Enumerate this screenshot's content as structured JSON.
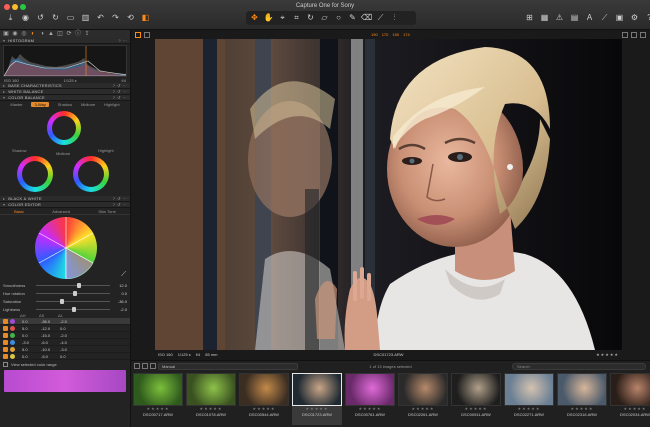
{
  "window": {
    "title": "Capture One for Sony"
  },
  "toolbar": {
    "left_icons": [
      "import-icon",
      "camera-icon",
      "undo-rotate-icon",
      "rotate-icon",
      "batch-icon",
      "trash-icon",
      "undo-icon",
      "redo-icon",
      "reset-icon",
      "copy-icon"
    ],
    "mid_icons": [
      "pan-icon",
      "hand-icon",
      "picker-icon",
      "crop-icon",
      "straighten-icon",
      "keystone-icon",
      "spot-icon",
      "brush-icon",
      "eraser-icon",
      "wb-picker-icon",
      "levels-icon"
    ],
    "right_icons": [
      "grid-icon",
      "guides-icon",
      "exposure-warning-icon",
      "focus-mask-icon",
      "text-icon",
      "eyedropper-icon",
      "proof-icon",
      "settings-icon",
      "help-icon"
    ]
  },
  "left_panel": {
    "histogram": {
      "title": "HISTOGRAM",
      "iso": "ISO 160",
      "shutter": "1/125 s",
      "aperture": "f/4"
    },
    "sections": {
      "base": "BASE CHARACTERISTICS",
      "wb": "WHITE BALANCE",
      "cb": "COLOR BALANCE",
      "bw": "BLACK & WHITE",
      "ce": "COLOR EDITOR"
    },
    "cb_tabs": [
      "Master",
      "3-Way",
      "Shadow",
      "Midtone",
      "Highlight"
    ],
    "cb_active": "3-Way",
    "wheel_labels": {
      "shadow": "Shadow",
      "midtone": "Midtone",
      "highlight": "Highlight"
    },
    "ce_tabs": [
      "Basic",
      "Advanced",
      "Skin Tone"
    ],
    "sliders": [
      {
        "label": "Smoothness",
        "value": "12.0",
        "pos": 0.55
      },
      {
        "label": "Hue rotation",
        "value": "0.0",
        "pos": 0.5
      },
      {
        "label": "Saturation",
        "value": "-36.0",
        "pos": 0.32
      },
      {
        "label": "Lightness",
        "value": "-2.0",
        "pos": 0.49
      }
    ],
    "table_head": [
      "ΔH",
      "ΔS",
      "ΔL"
    ],
    "table_rows": [
      {
        "color": "#a24bd6",
        "h": "0.0",
        "s": "-36.0",
        "l": "-2.0",
        "sel": true
      },
      {
        "color": "#e25050",
        "h": "5.0",
        "s": "-12.0",
        "l": "0.0",
        "sel": false
      },
      {
        "color": "#3fb64a",
        "h": "0.0",
        "s": "-15.0",
        "l": "-2.0",
        "sel": false
      },
      {
        "color": "#3c8be0",
        "h": "-3.0",
        "s": "-6.0",
        "l": "-4.0",
        "sel": false
      },
      {
        "color": "#e0a23a",
        "h": "5.0",
        "s": "-10.0",
        "l": "-3.0",
        "sel": false
      },
      {
        "color": "#d8c840",
        "h": "0.0",
        "s": "-5.0",
        "l": "0.0",
        "sel": false
      }
    ],
    "view_selected": "View selected color range",
    "accent": "#ff8a1a"
  },
  "viewer": {
    "top_info": [
      "190",
      "170",
      "150",
      "174"
    ],
    "bottom_info": {
      "iso": "ISO 160",
      "shutter": "1/125 s",
      "aperture": "f/4",
      "focal": "85 mm"
    },
    "filename": "DSC01723.ARW",
    "stars": "★★★★★"
  },
  "browser": {
    "sort_label": "Manual",
    "count": "1 of 13 images selected",
    "search_placeholder": "Search",
    "thumbs": [
      {
        "name": "DSC00717.ARW",
        "c1": "#2f5a1e",
        "c2": "#7bbf3a",
        "sel": false
      },
      {
        "name": "DSC01078.ARW",
        "c1": "#3a5220",
        "c2": "#8ec24a",
        "sel": false
      },
      {
        "name": "DSC00544.ARW",
        "c1": "#3a2d22",
        "c2": "#c38a4a",
        "sel": false
      },
      {
        "name": "DSC01723.ARW",
        "c1": "#1f2a33",
        "c2": "#c9a688",
        "sel": true
      },
      {
        "name": "DSC00761.ARW",
        "c1": "#6a2a6a",
        "c2": "#e06ad8",
        "sel": false
      },
      {
        "name": "DSC02261.ARW",
        "c1": "#2a2a2a",
        "c2": "#b78a6a",
        "sel": false
      },
      {
        "name": "DSC00911.ARW",
        "c1": "#1e1e1e",
        "c2": "#b0a08a",
        "sel": false
      },
      {
        "name": "DSC02271.ARW",
        "c1": "#6a7f94",
        "c2": "#d3c2b0",
        "sel": false
      },
      {
        "name": "DSC02316.ARW",
        "c1": "#4a5a6a",
        "c2": "#d7b59a",
        "sel": false
      },
      {
        "name": "DSC02034.ARW",
        "c1": "#2a1e18",
        "c2": "#b9846a",
        "sel": false
      }
    ]
  }
}
